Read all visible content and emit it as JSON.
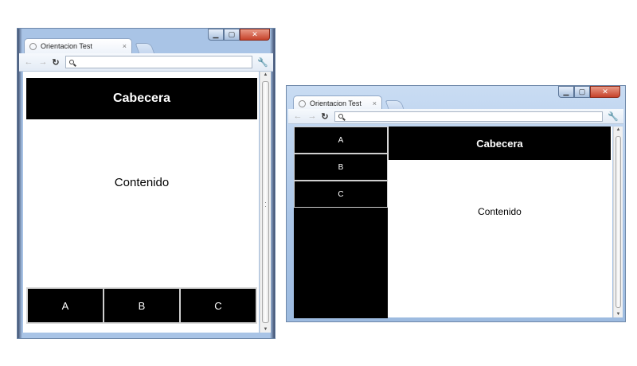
{
  "portrait": {
    "tab_title": "Orientacion Test",
    "tab_close": "×",
    "header": "Cabecera",
    "content": "Contenido",
    "buttons": [
      "A",
      "B",
      "C"
    ]
  },
  "landscape": {
    "tab_title": "Orientacion Test",
    "tab_close": "×",
    "header": "Cabecera",
    "content": "Contenido",
    "buttons": [
      "A",
      "B",
      "C"
    ]
  },
  "icons": {
    "back": "back-arrow-icon",
    "forward": "forward-arrow-icon",
    "reload": "reload-icon",
    "search": "search-icon",
    "wrench": "wrench-icon",
    "minimize": "minimize-icon",
    "maximize": "maximize-icon",
    "close": "close-icon"
  },
  "colors": {
    "header_bg": "#000000",
    "text_light": "#ffffff",
    "content_bg": "#ffffff"
  }
}
